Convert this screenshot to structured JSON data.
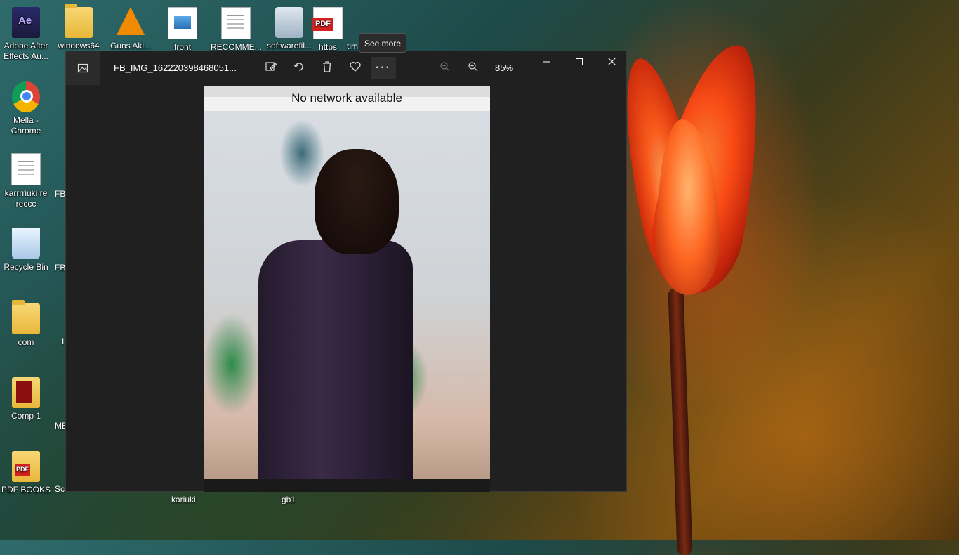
{
  "desktop": {
    "icons": [
      {
        "label": "Adobe After Effects Au...",
        "icon": "after-effects-icon"
      },
      {
        "label": "windows64",
        "icon": "folder-icon"
      },
      {
        "label": "Guns Aki...",
        "icon": "vlc-icon"
      },
      {
        "label": "front",
        "icon": "image-file-icon"
      },
      {
        "label": "RECOMME...",
        "icon": "document-icon"
      },
      {
        "label": "softwarefil...",
        "icon": "installer-icon"
      },
      {
        "label": "https",
        "icon": "pdf-icon"
      },
      {
        "label": "tim",
        "icon": "file-icon"
      },
      {
        "label": "Mella - Chrome",
        "icon": "chrome-icon"
      },
      {
        "label": "karrrriuki re reccc",
        "icon": "document-icon"
      },
      {
        "label": "Recycle Bin",
        "icon": "recycle-bin-icon"
      },
      {
        "label": "com",
        "icon": "folder-icon"
      },
      {
        "label": "Comp 1",
        "icon": "folder-icon"
      },
      {
        "label": "PDF BOOKS",
        "icon": "pdf-folder-icon"
      }
    ],
    "partial_labels": [
      "FB",
      "FB",
      "I",
      "ME",
      "Sc",
      "kariuki",
      "gb1"
    ]
  },
  "tooltip": {
    "text": "See more"
  },
  "photos_window": {
    "title": "FB_IMG_162220398468051...",
    "zoom": "85%",
    "toolbar_icons": [
      "edit-icon",
      "rotate-icon",
      "delete-icon",
      "favorite-icon",
      "more-icon",
      "zoom-out-icon",
      "zoom-in-icon"
    ],
    "window_controls": [
      "minimize-icon",
      "maximize-icon",
      "close-icon"
    ],
    "photo_caption": "No network available"
  },
  "colors": {
    "window_bg": "#202020",
    "accent": "#ff5a1a"
  }
}
